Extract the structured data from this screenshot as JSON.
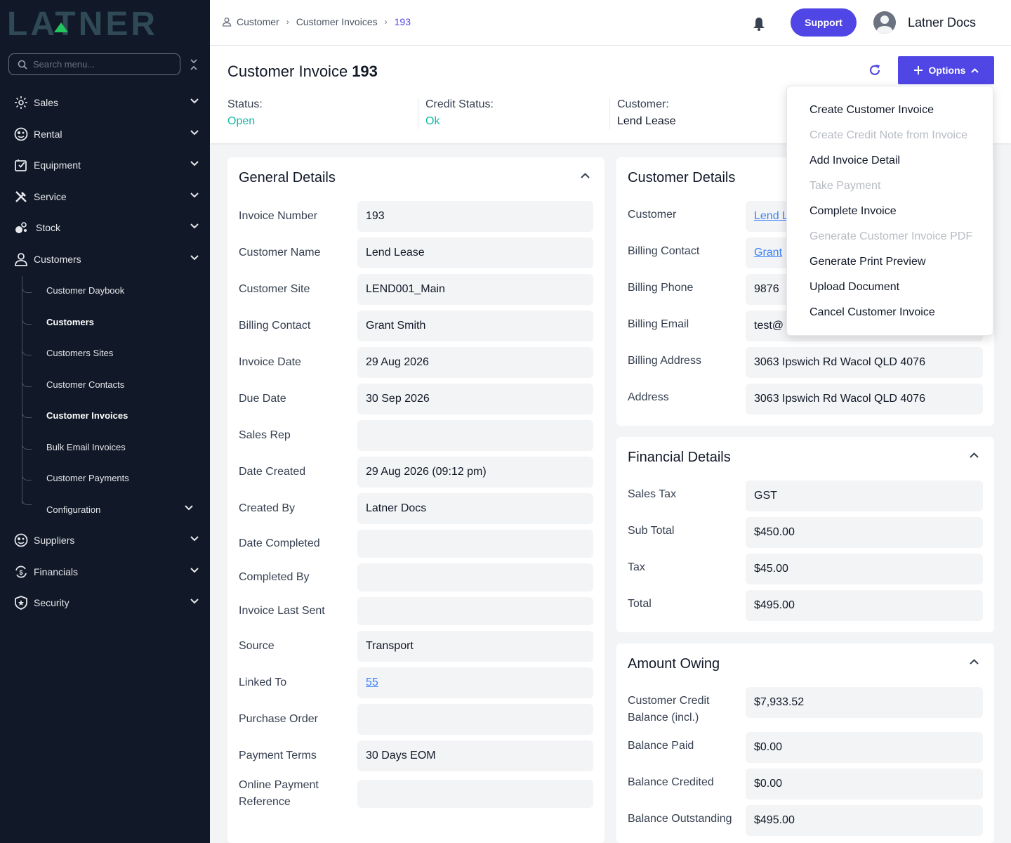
{
  "app": {
    "logo_text": "LATNER"
  },
  "search": {
    "placeholder": "Search menu..."
  },
  "sidebar": {
    "items": [
      {
        "label": "Sales",
        "icon": "sales-icon"
      },
      {
        "label": "Rental",
        "icon": "rental-icon"
      },
      {
        "label": "Equipment",
        "icon": "equipment-icon"
      },
      {
        "label": "Service",
        "icon": "service-icon"
      },
      {
        "label": "Stock",
        "icon": "stock-icon"
      },
      {
        "label": "Customers",
        "icon": "user-icon"
      },
      {
        "label": "Suppliers",
        "icon": "suppliers-icon"
      },
      {
        "label": "Financials",
        "icon": "financials-icon"
      },
      {
        "label": "Security",
        "icon": "shield-icon"
      }
    ],
    "customers_sub": [
      {
        "label": "Customer Daybook"
      },
      {
        "label": "Customers"
      },
      {
        "label": "Customers Sites"
      },
      {
        "label": "Customer Contacts"
      },
      {
        "label": "Customer Invoices"
      },
      {
        "label": "Bulk Email Invoices"
      },
      {
        "label": "Customer Payments"
      },
      {
        "label": "Configuration"
      }
    ]
  },
  "breadcrumb": {
    "items": [
      "Customer",
      "Customer Invoices",
      "193"
    ]
  },
  "topbar": {
    "support_label": "Support",
    "user_name": "Latner Docs"
  },
  "header": {
    "title": "Customer Invoice",
    "number": "193",
    "options_label": "Options",
    "status_label": "Status:",
    "status_value": "Open",
    "credit_label": "Credit Status:",
    "credit_value": "Ok",
    "customer_label": "Customer:",
    "customer_value": "Lend Lease"
  },
  "colors": {
    "accent": "#4f46e5",
    "status_teal": "#14b8a6",
    "sidebar_bg": "#111827",
    "link": "#3b82f6"
  },
  "general": {
    "title": "General Details",
    "rows": [
      {
        "label": "Invoice Number",
        "value": "193"
      },
      {
        "label": "Customer Name",
        "value": "Lend Lease"
      },
      {
        "label": "Customer Site",
        "value": "LEND001_Main"
      },
      {
        "label": "Billing Contact",
        "value": "Grant Smith"
      },
      {
        "label": "Invoice Date",
        "value": "29 Aug 2026"
      },
      {
        "label": "Due Date",
        "value": "30 Sep 2026"
      },
      {
        "label": "Sales Rep",
        "value": ""
      },
      {
        "label": "Date Created",
        "value": "29 Aug 2026 (09:12 pm)"
      },
      {
        "label": "Created By",
        "value": "Latner Docs"
      },
      {
        "label": "Date Completed",
        "value": ""
      },
      {
        "label": "Completed By",
        "value": ""
      },
      {
        "label": "Invoice Last Sent",
        "value": ""
      },
      {
        "label": "Source",
        "value": "Transport"
      },
      {
        "label": "Linked To",
        "value": "55"
      },
      {
        "label": "Purchase Order",
        "value": ""
      },
      {
        "label": "Payment Terms",
        "value": "30 Days EOM"
      },
      {
        "label": "Online Payment Reference",
        "value": ""
      }
    ]
  },
  "customer_details": {
    "title": "Customer Details",
    "rows": [
      {
        "label": "Customer",
        "value": "Lend L"
      },
      {
        "label": "Billing Contact",
        "value": "Grant"
      },
      {
        "label": "Billing Phone",
        "value": "9876"
      },
      {
        "label": "Billing Email",
        "value": "test@"
      },
      {
        "label": "Billing Address",
        "value": "3063 Ipswich Rd Wacol QLD 4076"
      },
      {
        "label": "Address",
        "value": "3063 Ipswich Rd Wacol QLD 4076"
      }
    ]
  },
  "financial": {
    "title": "Financial Details",
    "rows": [
      {
        "label": "Sales Tax",
        "value": "GST"
      },
      {
        "label": "Sub Total",
        "value": "$450.00"
      },
      {
        "label": "Tax",
        "value": "$45.00"
      },
      {
        "label": "Total",
        "value": "$495.00"
      }
    ]
  },
  "owing": {
    "title": "Amount Owing",
    "rows": [
      {
        "label": "Customer Credit Balance (incl.)",
        "value": "$7,933.52"
      },
      {
        "label": "Balance Paid",
        "value": "$0.00"
      },
      {
        "label": "Balance Credited",
        "value": "$0.00"
      },
      {
        "label": "Balance Outstanding",
        "value": "$495.00"
      }
    ]
  },
  "options_menu": {
    "items": [
      {
        "label": "Create Customer Invoice",
        "enabled": true
      },
      {
        "label": "Create Credit Note from Invoice",
        "enabled": false
      },
      {
        "label": "Add Invoice Detail",
        "enabled": true
      },
      {
        "label": "Take Payment",
        "enabled": false
      },
      {
        "label": "Complete Invoice",
        "enabled": true
      },
      {
        "label": "Generate Customer Invoice PDF",
        "enabled": false
      },
      {
        "label": "Generate Print Preview",
        "enabled": true
      },
      {
        "label": "Upload Document",
        "enabled": true
      },
      {
        "label": "Cancel Customer Invoice",
        "enabled": true
      }
    ]
  }
}
